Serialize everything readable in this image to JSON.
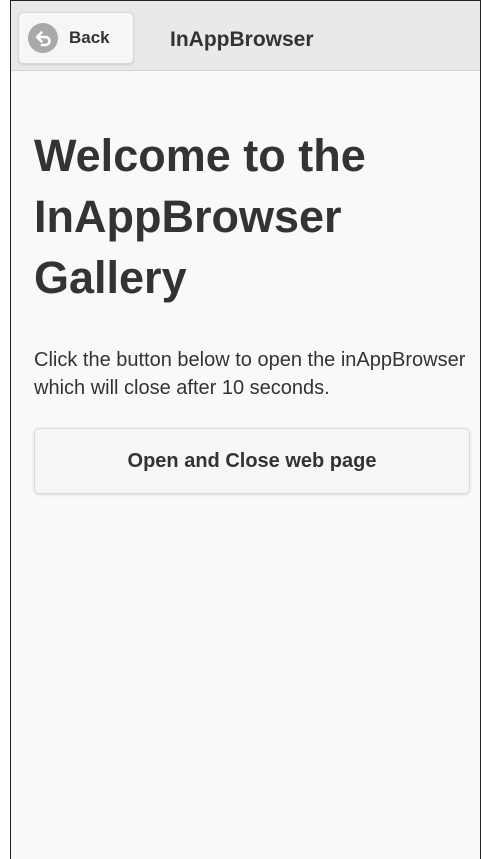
{
  "header": {
    "back_label": "Back",
    "back_icon": "back-arrow-icon",
    "title": "InAppBrowser"
  },
  "main": {
    "title": "Welcome to the InAppBrowser Gallery",
    "description": "Click the button below to open the inAppBrowser which will close after 10 seconds.",
    "button_label": "Open and Close web page"
  },
  "colors": {
    "header_bg": "#e9e9e9",
    "page_bg": "#f9f9f9",
    "button_bg": "#f6f6f6",
    "text": "#333333",
    "icon_bg": "#a9a9a9"
  }
}
